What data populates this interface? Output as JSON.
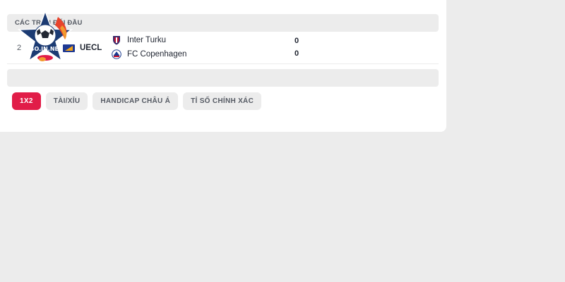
{
  "section": {
    "title": "CÁC TRẬN ĐỐI ĐẦU"
  },
  "match": {
    "date": "2",
    "league": "UECL",
    "home_team": "Inter Turku",
    "away_team": "FC Copenhagen",
    "home_score": "0",
    "away_score": "0"
  },
  "tabs": [
    {
      "label": "1X2",
      "active": true
    },
    {
      "label": "TÀI/XỈU",
      "active": false
    },
    {
      "label": "HANDICAP CHÂU Á",
      "active": false
    },
    {
      "label": "TỈ SỐ CHÍNH XÁC",
      "active": false
    }
  ],
  "site_logo": {
    "text": "XOSO.IN.NET"
  },
  "colors": {
    "accent": "#e11d48",
    "background": "#ececec",
    "card": "#ffffff",
    "text": "#222733"
  }
}
